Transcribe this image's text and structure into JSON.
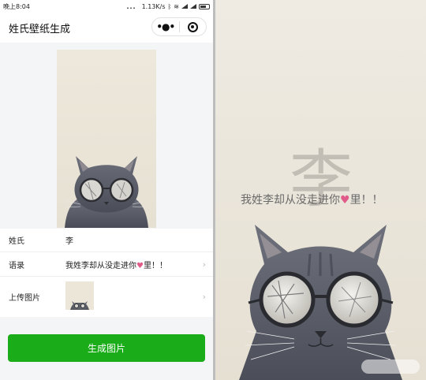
{
  "status_bar": {
    "time": "晚上8:04",
    "dots": "...",
    "speed": "1.13K/s"
  },
  "header": {
    "title": "姓氏壁纸生成"
  },
  "form": {
    "surname_label": "姓氏",
    "surname_value": "李",
    "quote_label": "语录",
    "quote_before_heart": "我姓李却从没走进你",
    "quote_after_heart": "里！！",
    "upload_label": "上传图片"
  },
  "actions": {
    "generate_label": "生成图片"
  },
  "wallpaper": {
    "big_char": "李",
    "quote_before_heart": "我姓李却从没走进你",
    "quote_after_heart": "里！！"
  },
  "colors": {
    "accent_green": "#1aad19",
    "heart_pink": "#e05b8a"
  },
  "icons": [
    "more-dots-icon",
    "record-target-icon",
    "chevron-right-icon",
    "heart-icon",
    "wifi-icon",
    "bluetooth-icon",
    "battery-icon",
    "signal-icon"
  ]
}
